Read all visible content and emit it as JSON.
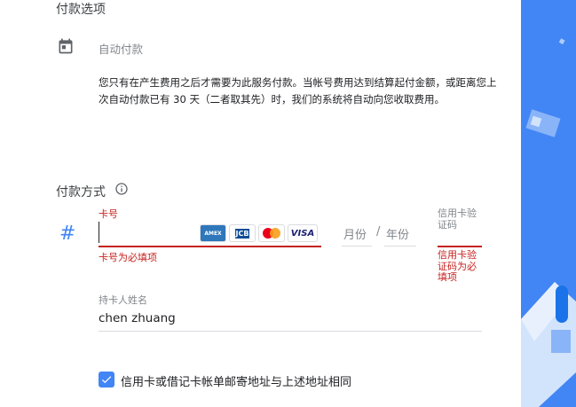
{
  "payment_options": {
    "title": "付款选项",
    "auto_pay_label": "自动付款",
    "description": "您只有在产生费用之后才需要为此服务付款。当帐号费用达到结算起付金额，或距离您上次自动付款已有 30 天（二者取其先）时，我们的系统将自动向您收取费用。"
  },
  "payment_method": {
    "title": "付款方式",
    "card_number": {
      "label": "卡号",
      "error": "卡号为必填项",
      "value": ""
    },
    "card_logos": [
      "AMEX",
      "JCB",
      "MasterCard",
      "VISA"
    ],
    "expiry": {
      "month_placeholder": "月份",
      "separator": "/",
      "year_placeholder": "年份"
    },
    "cvc": {
      "label": "信用卡验证码",
      "error": "信用卡验证码为必填项"
    },
    "cardholder": {
      "label": "持卡人姓名",
      "value": "chen zhuang"
    },
    "same_address": {
      "label": "信用卡或借记卡帐单邮寄地址与上述地址相同",
      "checked": true
    }
  },
  "colors": {
    "accent": "#4285f4",
    "error": "#c5221f"
  }
}
